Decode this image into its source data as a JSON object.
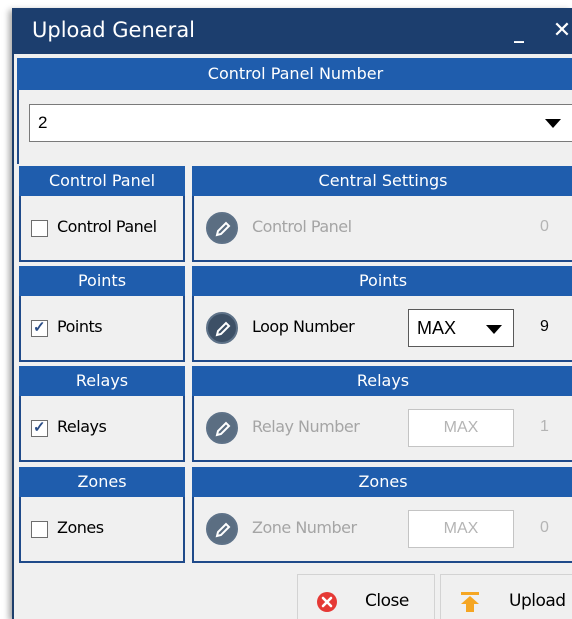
{
  "window": {
    "title": "Upload General",
    "minimize_glyph": "_",
    "close_glyph": "✕"
  },
  "control_panel_number": {
    "header": "Control Panel Number",
    "selected": "2"
  },
  "sections": [
    {
      "left_header": "Control Panel",
      "checkbox_label": "Control Panel",
      "checked": false,
      "right_header": "Central Settings",
      "field_label": "Control Panel",
      "field_enabled": false,
      "value": "0"
    },
    {
      "left_header": "Points",
      "checkbox_label": "Points",
      "checked": true,
      "right_header": "Points",
      "field_label": "Loop Number",
      "field_enabled": true,
      "dropdown_value": "MAX",
      "value": "9"
    },
    {
      "left_header": "Relays",
      "checkbox_label": "Relays",
      "checked": true,
      "right_header": "Relays",
      "field_label": "Relay Number",
      "field_enabled": false,
      "dropdown_value": "MAX",
      "value": "1"
    },
    {
      "left_header": "Zones",
      "checkbox_label": "Zones",
      "checked": false,
      "right_header": "Zones",
      "field_label": "Zone Number",
      "field_enabled": false,
      "dropdown_value": "MAX",
      "value": "0"
    }
  ],
  "buttons": {
    "close_label": "Close",
    "upload_label": "Upload"
  },
  "icons": {
    "edit": "pencil-icon",
    "close": "red-x-circle-icon",
    "upload": "orange-up-arrow-icon",
    "check": "✓"
  },
  "colors": {
    "titlebar": "#1c3e6e",
    "section_header": "#1f5dad",
    "close_icon": "#e53935",
    "upload_icon": "#f5a623"
  }
}
